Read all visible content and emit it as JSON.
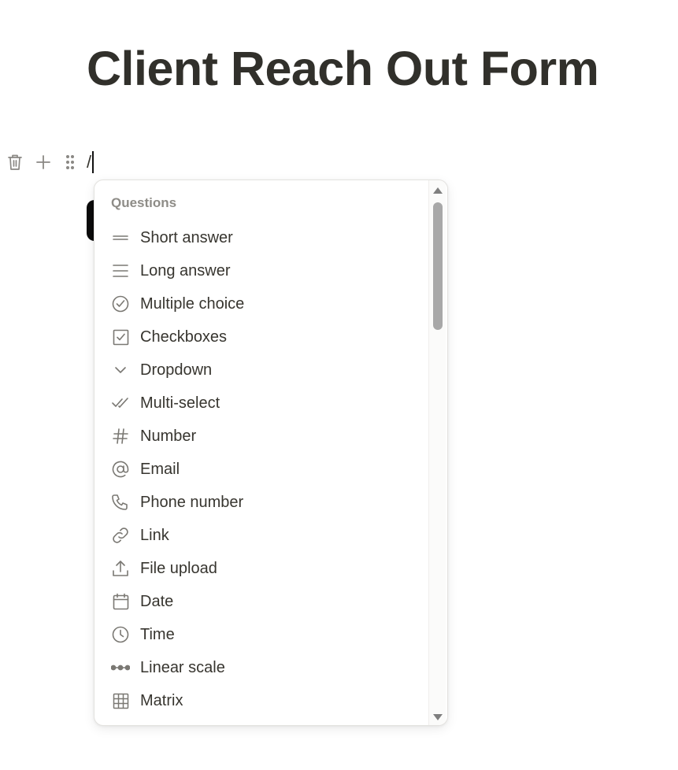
{
  "form": {
    "title": "Client Reach Out Form"
  },
  "block": {
    "input_value": "/",
    "toolbar_icons": [
      "trash-icon",
      "plus-icon",
      "drag-handle-icon"
    ]
  },
  "menu": {
    "section_label": "Questions",
    "items": [
      {
        "label": "Short answer",
        "icon": "short-answer-icon"
      },
      {
        "label": "Long answer",
        "icon": "long-answer-icon"
      },
      {
        "label": "Multiple choice",
        "icon": "multiple-choice-icon"
      },
      {
        "label": "Checkboxes",
        "icon": "checkbox-icon"
      },
      {
        "label": "Dropdown",
        "icon": "chevron-down-icon"
      },
      {
        "label": "Multi-select",
        "icon": "double-check-icon"
      },
      {
        "label": "Number",
        "icon": "hash-icon"
      },
      {
        "label": "Email",
        "icon": "at-icon"
      },
      {
        "label": "Phone number",
        "icon": "phone-icon"
      },
      {
        "label": "Link",
        "icon": "link-icon"
      },
      {
        "label": "File upload",
        "icon": "upload-icon"
      },
      {
        "label": "Date",
        "icon": "calendar-icon"
      },
      {
        "label": "Time",
        "icon": "clock-icon"
      },
      {
        "label": "Linear scale",
        "icon": "linear-scale-icon"
      },
      {
        "label": "Matrix",
        "icon": "grid-icon"
      }
    ]
  },
  "colors": {
    "title": "#31302b",
    "text": "#37352f",
    "muted": "#8e8c87",
    "icon": "#7a7873"
  }
}
